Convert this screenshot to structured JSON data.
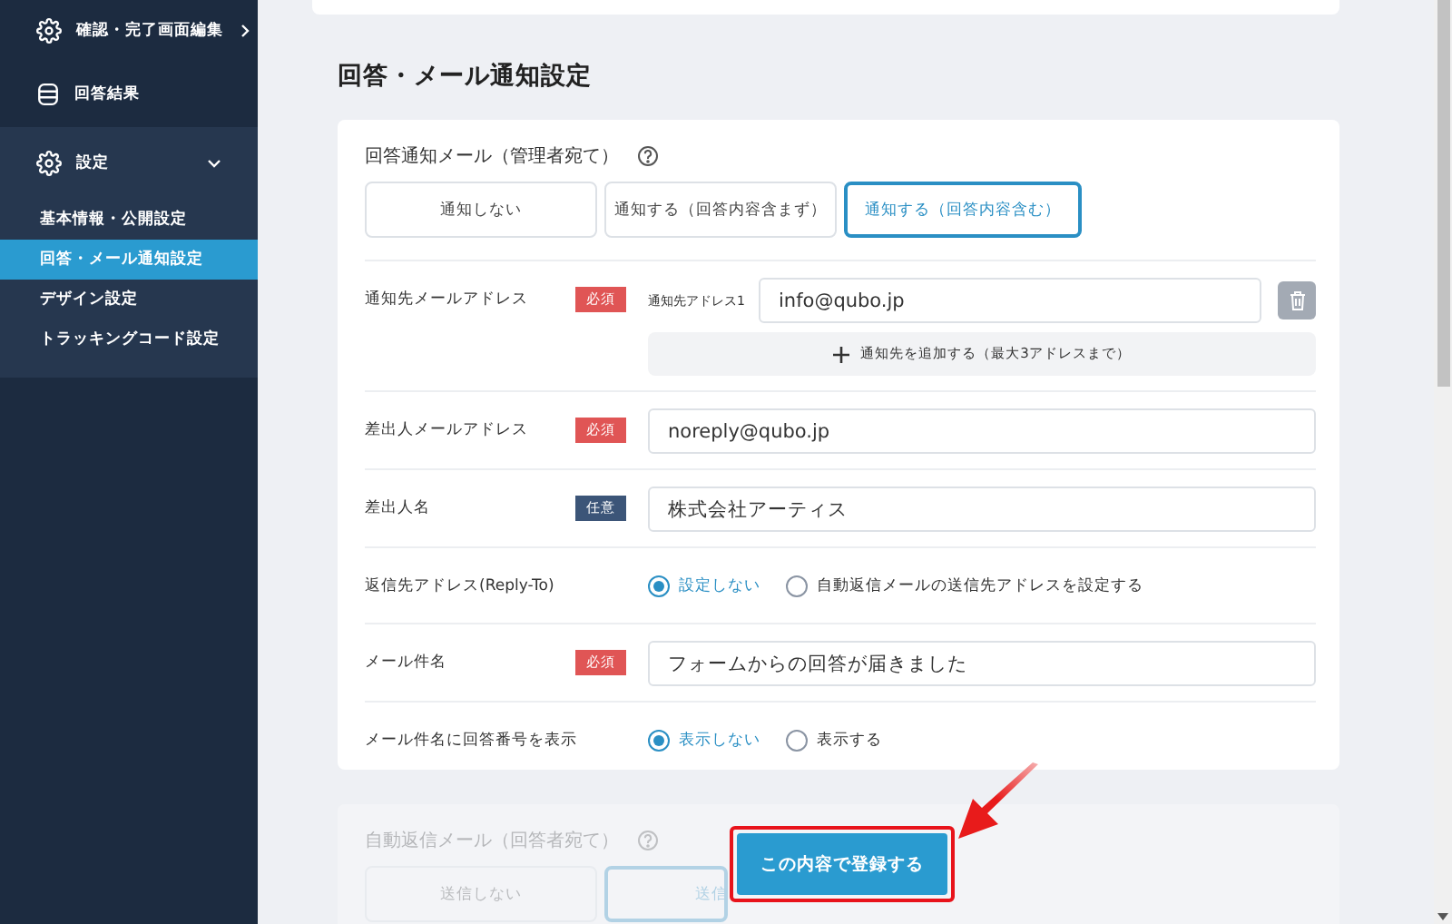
{
  "sidebar": {
    "items": [
      {
        "label": "確認・完了画面編集",
        "expanded": false
      },
      {
        "label": "回答結果"
      },
      {
        "label": "設定",
        "expanded": true,
        "children": [
          {
            "label": "基本情報・公開設定",
            "selected": false
          },
          {
            "label": "回答・メール通知設定",
            "selected": true
          },
          {
            "label": "デザイン設定",
            "selected": false
          },
          {
            "label": "トラッキングコード設定",
            "selected": false
          }
        ]
      }
    ]
  },
  "page_title": "回答・メール通知設定",
  "admin_mail": {
    "title": "回答通知メール（管理者宛て）",
    "tabs": [
      {
        "label": "通知しない",
        "selected": false
      },
      {
        "label": "通知する（回答内容含まず）",
        "selected": false
      },
      {
        "label": "通知する（回答内容含む）",
        "selected": true
      }
    ],
    "rows": [
      {
        "kind": "address_list",
        "label": "通知先メールアドレス",
        "badge": {
          "text": "必須",
          "kind": "required"
        },
        "addresses": [
          {
            "label": "通知先アドレス1",
            "value": "info@qubo.jp"
          }
        ],
        "add_button": "通知先を追加する（最大3アドレスまで）"
      },
      {
        "kind": "input",
        "label": "差出人メールアドレス",
        "badge": {
          "text": "必須",
          "kind": "required"
        },
        "value": "noreply@qubo.jp"
      },
      {
        "kind": "input",
        "label": "差出人名",
        "badge": {
          "text": "任意",
          "kind": "optional"
        },
        "value": "株式会社アーティス"
      },
      {
        "kind": "radio",
        "label": "返信先アドレス(Reply-To)",
        "options": [
          {
            "label": "設定しない",
            "selected": true
          },
          {
            "label": "自動返信メールの送信先アドレスを設定する",
            "selected": false
          }
        ]
      },
      {
        "kind": "input",
        "label": "メール件名",
        "badge": {
          "text": "必須",
          "kind": "required"
        },
        "value": "フォームからの回答が届きました"
      },
      {
        "kind": "radio",
        "label": "メール件名に回答番号を表示",
        "options": [
          {
            "label": "表示しない",
            "selected": true
          },
          {
            "label": "表示する",
            "selected": false
          }
        ]
      }
    ]
  },
  "auto_reply": {
    "title": "自動返信メール（回答者宛て）",
    "tabs": [
      {
        "label": "送信しない",
        "selected": false
      },
      {
        "label": "送信",
        "selected": true
      }
    ]
  },
  "submit_button": {
    "label": "この内容で登録する",
    "highlighted": true
  }
}
